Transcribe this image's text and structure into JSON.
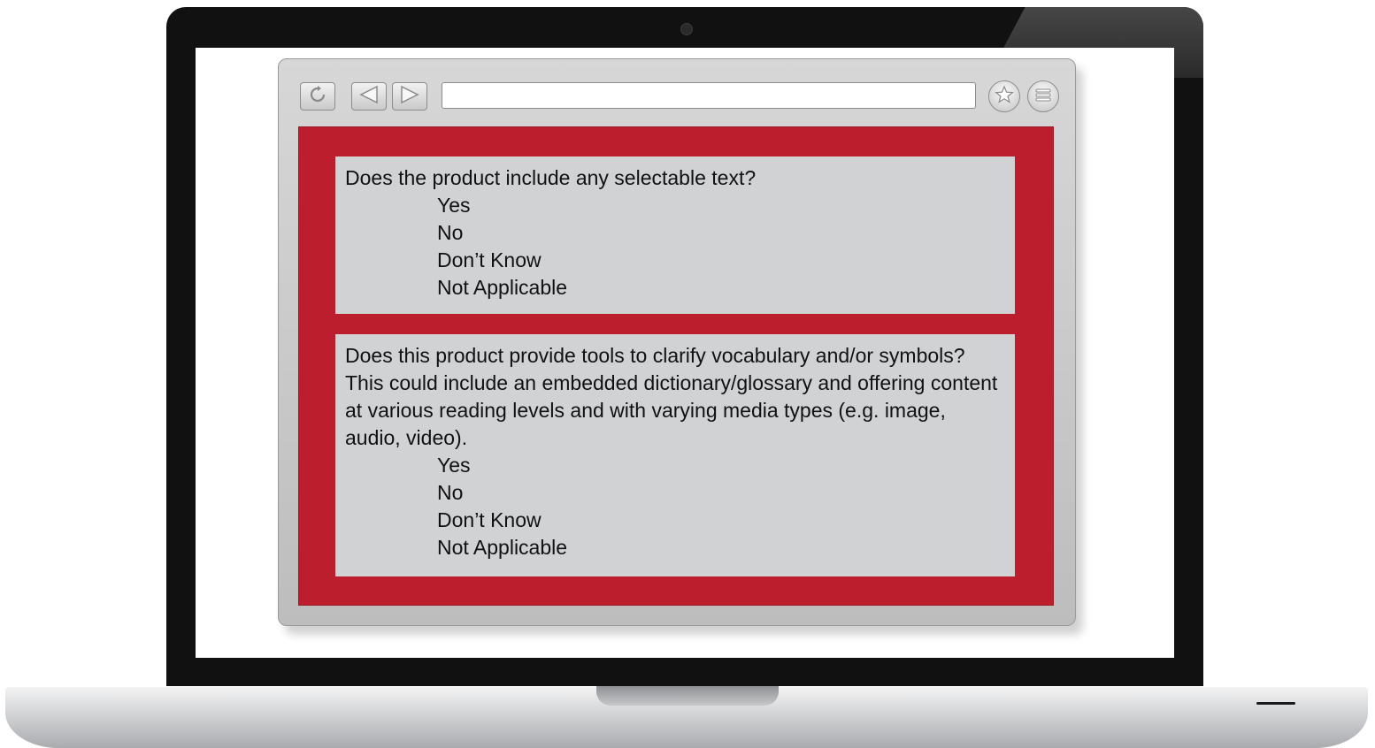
{
  "questions": [
    {
      "text": "Does the product include any selectable text?",
      "options": [
        "Yes",
        "No",
        "Don’t Know",
        "Not Applicable"
      ]
    },
    {
      "text": "Does this product provide tools to clarify vocabulary and/or symbols? This could include an embedded dictionary/glossary and offering content at various reading levels and with varying media types (e.g. image, audio, video).",
      "options": [
        "Yes",
        "No",
        "Don’t Know",
        "Not Applicable"
      ]
    }
  ],
  "toolbar": {
    "icons": [
      "refresh-icon",
      "back-arrow-icon",
      "forward-arrow-icon",
      "star-icon",
      "menu-icon"
    ],
    "url_value": ""
  },
  "colors": {
    "content_background": "#bc1e2e",
    "question_panel": "#d1d2d4",
    "bezel": "#111111"
  }
}
